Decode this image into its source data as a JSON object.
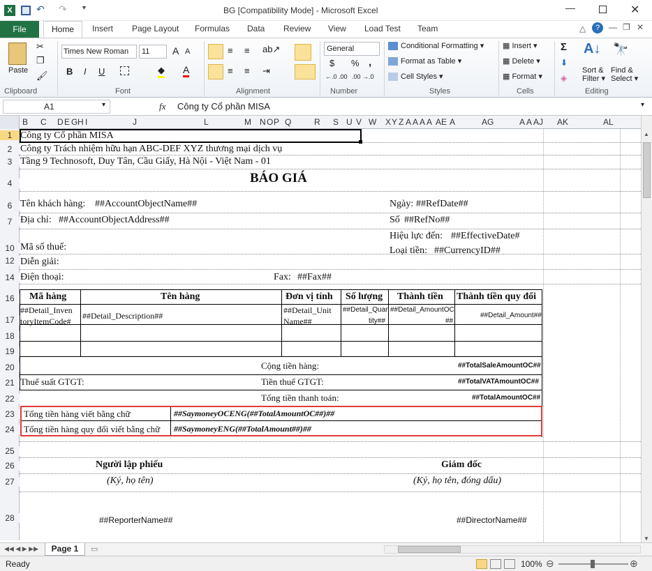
{
  "window": {
    "title": "BG  [Compatibility Mode]  -  Microsoft Excel"
  },
  "tabs": [
    "File",
    "Home",
    "Insert",
    "Page Layout",
    "Formulas",
    "Data",
    "Review",
    "View",
    "Load Test",
    "Team"
  ],
  "ribbon": {
    "clipboard": {
      "paste": "Paste",
      "label": "Clipboard"
    },
    "font": {
      "name": "Times New Roman",
      "size": "11",
      "label": "Font",
      "bold": "B",
      "italic": "I",
      "underline": "U",
      "grow": "A",
      "shrink": "A",
      "fontcolor": "A"
    },
    "alignment": {
      "label": "Alignment"
    },
    "number": {
      "format": "General",
      "label": "Number",
      "currency": "$",
      "percent": "%",
      "comma": ",",
      "inc": "←.0 .00",
      "dec": ".00 →.0"
    },
    "styles": {
      "conditional": "Conditional Formatting",
      "table": "Format as Table",
      "cell": "Cell Styles",
      "label": "Styles"
    },
    "cells": {
      "insert": "Insert",
      "delete": "Delete",
      "format": "Format",
      "label": "Cells"
    },
    "editing": {
      "sort": "Sort &",
      "filter": "Filter",
      "find": "Find &",
      "select": "Select",
      "label": "Editing",
      "sigma": "Σ"
    }
  },
  "formula_bar": {
    "name_box": "A1",
    "fx": "fx",
    "value": "Công ty Cổ phần MISA"
  },
  "columns": [
    "B",
    "C",
    "D",
    "E",
    "G",
    "H",
    "I",
    "J",
    "L",
    "M",
    "N",
    "O",
    "P",
    "Q",
    "R",
    "S",
    "U",
    "V",
    "W",
    "X",
    "Y",
    "Z",
    "A",
    "A",
    "A",
    "A",
    "AE",
    "A",
    "AG",
    "A",
    "A",
    "AJ",
    "AK",
    "AL"
  ],
  "rows": [
    "1",
    "2",
    "3",
    "4",
    "6",
    "7",
    "10",
    "12",
    "14",
    "16",
    "17",
    "18",
    "19",
    "20",
    "21",
    "22",
    "23",
    "24",
    "25",
    "26",
    "27",
    "28"
  ],
  "sheet": {
    "company": "Công ty Cổ phần MISA",
    "company2": "Công ty Trách nhiệm hữu hạn ABC-DEF XYZ thương mại dịch vụ",
    "address": "Tầng 9 Technosoft, Duy Tân, Cầu Giấy, Hà Nội - Việt Nam - 01",
    "title": "BÁO GIÁ",
    "customer_label": "Tên khách hàng:",
    "customer_val": "##AccountObjectName##",
    "addr_label": "Địa chỉ:",
    "addr_val": "##AccountObjectAddress##",
    "tax_label": "Mã số thuế:",
    "desc_label": "Diễn giải:",
    "phone_label": "Điện thoại:",
    "fax_label": "Fax:",
    "fax_val": "##Fax##",
    "date_label": "Ngày:",
    "date_val": "##RefDate##",
    "no_label": "Số",
    "no_val": "##RefNo##",
    "eff_label": "Hiệu lực đến:",
    "eff_val": "##EffectiveDate#",
    "cur_label": "Loại tiền:",
    "cur_val": "##CurrencyID##",
    "th": [
      "Mã hàng",
      "Tên hàng",
      "Đơn vị tính",
      "Số lượng",
      "Thành tiền",
      "Thành tiền quy đổi"
    ],
    "row17": {
      "code1": "##Detail_Inven",
      "code2": "toryItemCode#",
      "desc": "##Detail_Description##",
      "unit1": "##Detail_Unit",
      "unit2": "Name##",
      "qty1": "##Detail_Quan",
      "qty2": "tity##",
      "amt1": "##Detail_AmountOC",
      "amt2": "##",
      "amount": "##Detail_Amount##"
    },
    "total_label": "Cộng tiền hàng:",
    "total_val": "##TotalSaleAmountOC##",
    "vat_rate": "Thuế suất GTGT:",
    "vat_label": "Tiền thuế GTGT:",
    "vat_val": "##TotalVATAmountOC##",
    "pay_label": "Tổng tiền thanh toán:",
    "pay_val": "##TotalAmountOC##",
    "words_label": "Tổng tiền hàng viết bằng chữ",
    "words_val": "##SaymoneyOCENG(##TotalAmountOC##)##",
    "words2_label": "Tổng tiền hàng quy đổi viết bằng chữ",
    "words2_val": "##SaymoneyENG(##TotalAmount##)##",
    "reporter": "Người lập phiếu",
    "reporter_sign": "(Ký, họ tên)",
    "reporter_name": "##ReporterName##",
    "director": "Giám đốc",
    "director_sign": "(Ký, họ tên, đóng dấu)",
    "director_name": "##DirectorName##"
  },
  "sheet_tab": "Page 1",
  "status": {
    "ready": "Ready",
    "zoom": "100%"
  }
}
